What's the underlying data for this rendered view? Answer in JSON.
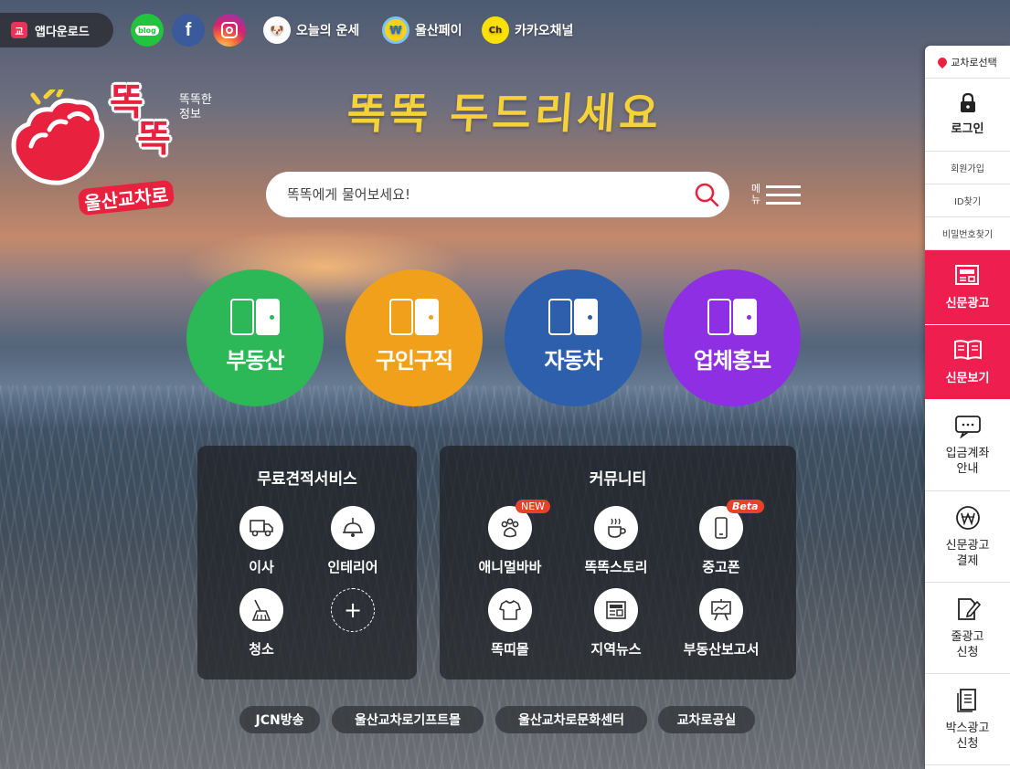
{
  "topbar": {
    "app_download": "앱다운로드",
    "links": [
      {
        "label": "오늘의 운세",
        "icon": "dog-icon"
      },
      {
        "label": "울산페이",
        "icon": "won-coin-icon"
      },
      {
        "label": "카카오채널",
        "icon": "kakao-channel-icon"
      }
    ],
    "social": {
      "blog": "blog",
      "facebook": "f"
    }
  },
  "logo": {
    "main_line1": "똑",
    "main_line2": "똑",
    "sub": "울산교차로",
    "tag": "똑똑한\n정보"
  },
  "slogan": "똑똑 두드리세요",
  "search": {
    "placeholder": "똑똑에게 물어보세요!"
  },
  "menu": {
    "label": "메뉴"
  },
  "categories": [
    {
      "label": "부동산",
      "color": "#2cb856"
    },
    {
      "label": "구인구직",
      "color": "#f0a01a"
    },
    {
      "label": "자동차",
      "color": "#2e5fac"
    },
    {
      "label": "업체홍보",
      "color": "#8f2fe4"
    }
  ],
  "estimate_panel": {
    "title": "무료견적서비스",
    "items": [
      "이사",
      "인테리어",
      "청소"
    ]
  },
  "community_panel": {
    "title": "커뮤니티",
    "items": [
      {
        "label": "애니멀바바",
        "badge": "NEW"
      },
      {
        "label": "똑똑스토리",
        "badge": ""
      },
      {
        "label": "중고폰",
        "badge": "Beta"
      },
      {
        "label": "똑띠몰",
        "badge": ""
      },
      {
        "label": "지역뉴스",
        "badge": ""
      },
      {
        "label": "부동산보고서",
        "badge": ""
      }
    ]
  },
  "bottom_links": [
    "JCN방송",
    "울산교차로기프트몰",
    "울산교차로문화센터",
    "교차로공실"
  ],
  "sidebar": {
    "region_select": "교차로선택",
    "login": "로그인",
    "join": "회원가입",
    "find_id": "ID찾기",
    "find_pw": "비밀번호찾기",
    "newspaper_ad": "신문광고",
    "newspaper_view": "신문보기",
    "deposit_account": "입금계좌\n안내",
    "newspaper_payment": "신문광고\n결제",
    "line_ad": "줄광고\n신청",
    "box_ad": "박스광고\n신청"
  }
}
